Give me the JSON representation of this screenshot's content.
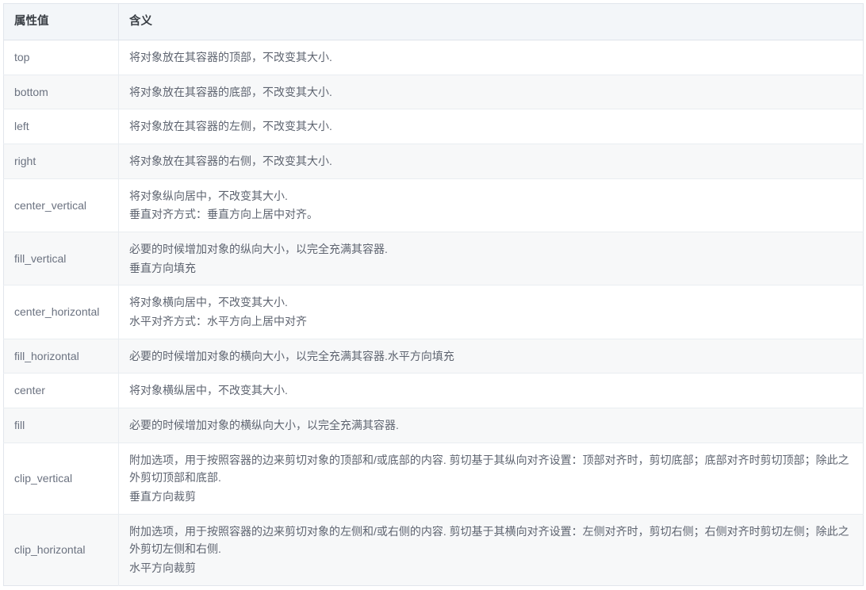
{
  "table": {
    "headers": {
      "value": "属性值",
      "meaning": "含义"
    },
    "rows": [
      {
        "value": "top",
        "lines": [
          "将对象放在其容器的顶部，不改变其大小."
        ]
      },
      {
        "value": "bottom",
        "lines": [
          "将对象放在其容器的底部，不改变其大小."
        ]
      },
      {
        "value": "left",
        "lines": [
          "将对象放在其容器的左侧，不改变其大小."
        ]
      },
      {
        "value": "right",
        "lines": [
          "将对象放在其容器的右侧，不改变其大小."
        ]
      },
      {
        "value": "center_vertical",
        "lines": [
          "将对象纵向居中，不改变其大小.",
          "垂直对齐方式：垂直方向上居中对齐。"
        ]
      },
      {
        "value": "fill_vertical",
        "lines": [
          "必要的时候增加对象的纵向大小，以完全充满其容器.",
          "垂直方向填充"
        ]
      },
      {
        "value": "center_horizontal",
        "lines": [
          "将对象横向居中，不改变其大小.",
          "水平对齐方式：水平方向上居中对齐"
        ]
      },
      {
        "value": "fill_horizontal",
        "lines": [
          "必要的时候增加对象的横向大小，以完全充满其容器.水平方向填充"
        ]
      },
      {
        "value": "center",
        "lines": [
          "将对象横纵居中，不改变其大小."
        ]
      },
      {
        "value": "fill",
        "lines": [
          "必要的时候增加对象的横纵向大小，以完全充满其容器."
        ]
      },
      {
        "value": "clip_vertical",
        "lines": [
          "附加选项，用于按照容器的边来剪切对象的顶部和/或底部的内容. 剪切基于其纵向对齐设置：顶部对齐时，剪切底部；底部对齐时剪切顶部；除此之外剪切顶部和底部.",
          "垂直方向裁剪"
        ]
      },
      {
        "value": "clip_horizontal",
        "lines": [
          "附加选项，用于按照容器的边来剪切对象的左侧和/或右侧的内容. 剪切基于其横向对齐设置：左侧对齐时，剪切右侧；右侧对齐时剪切左侧；除此之外剪切左侧和右侧.",
          "水平方向裁剪"
        ]
      }
    ]
  },
  "colors": {
    "header_bg": "#f3f6f9",
    "row_alt_bg": "#f7f8f9",
    "border": "#e9edf1",
    "header_text": "#3a3f45",
    "body_text": "#5e6470"
  }
}
